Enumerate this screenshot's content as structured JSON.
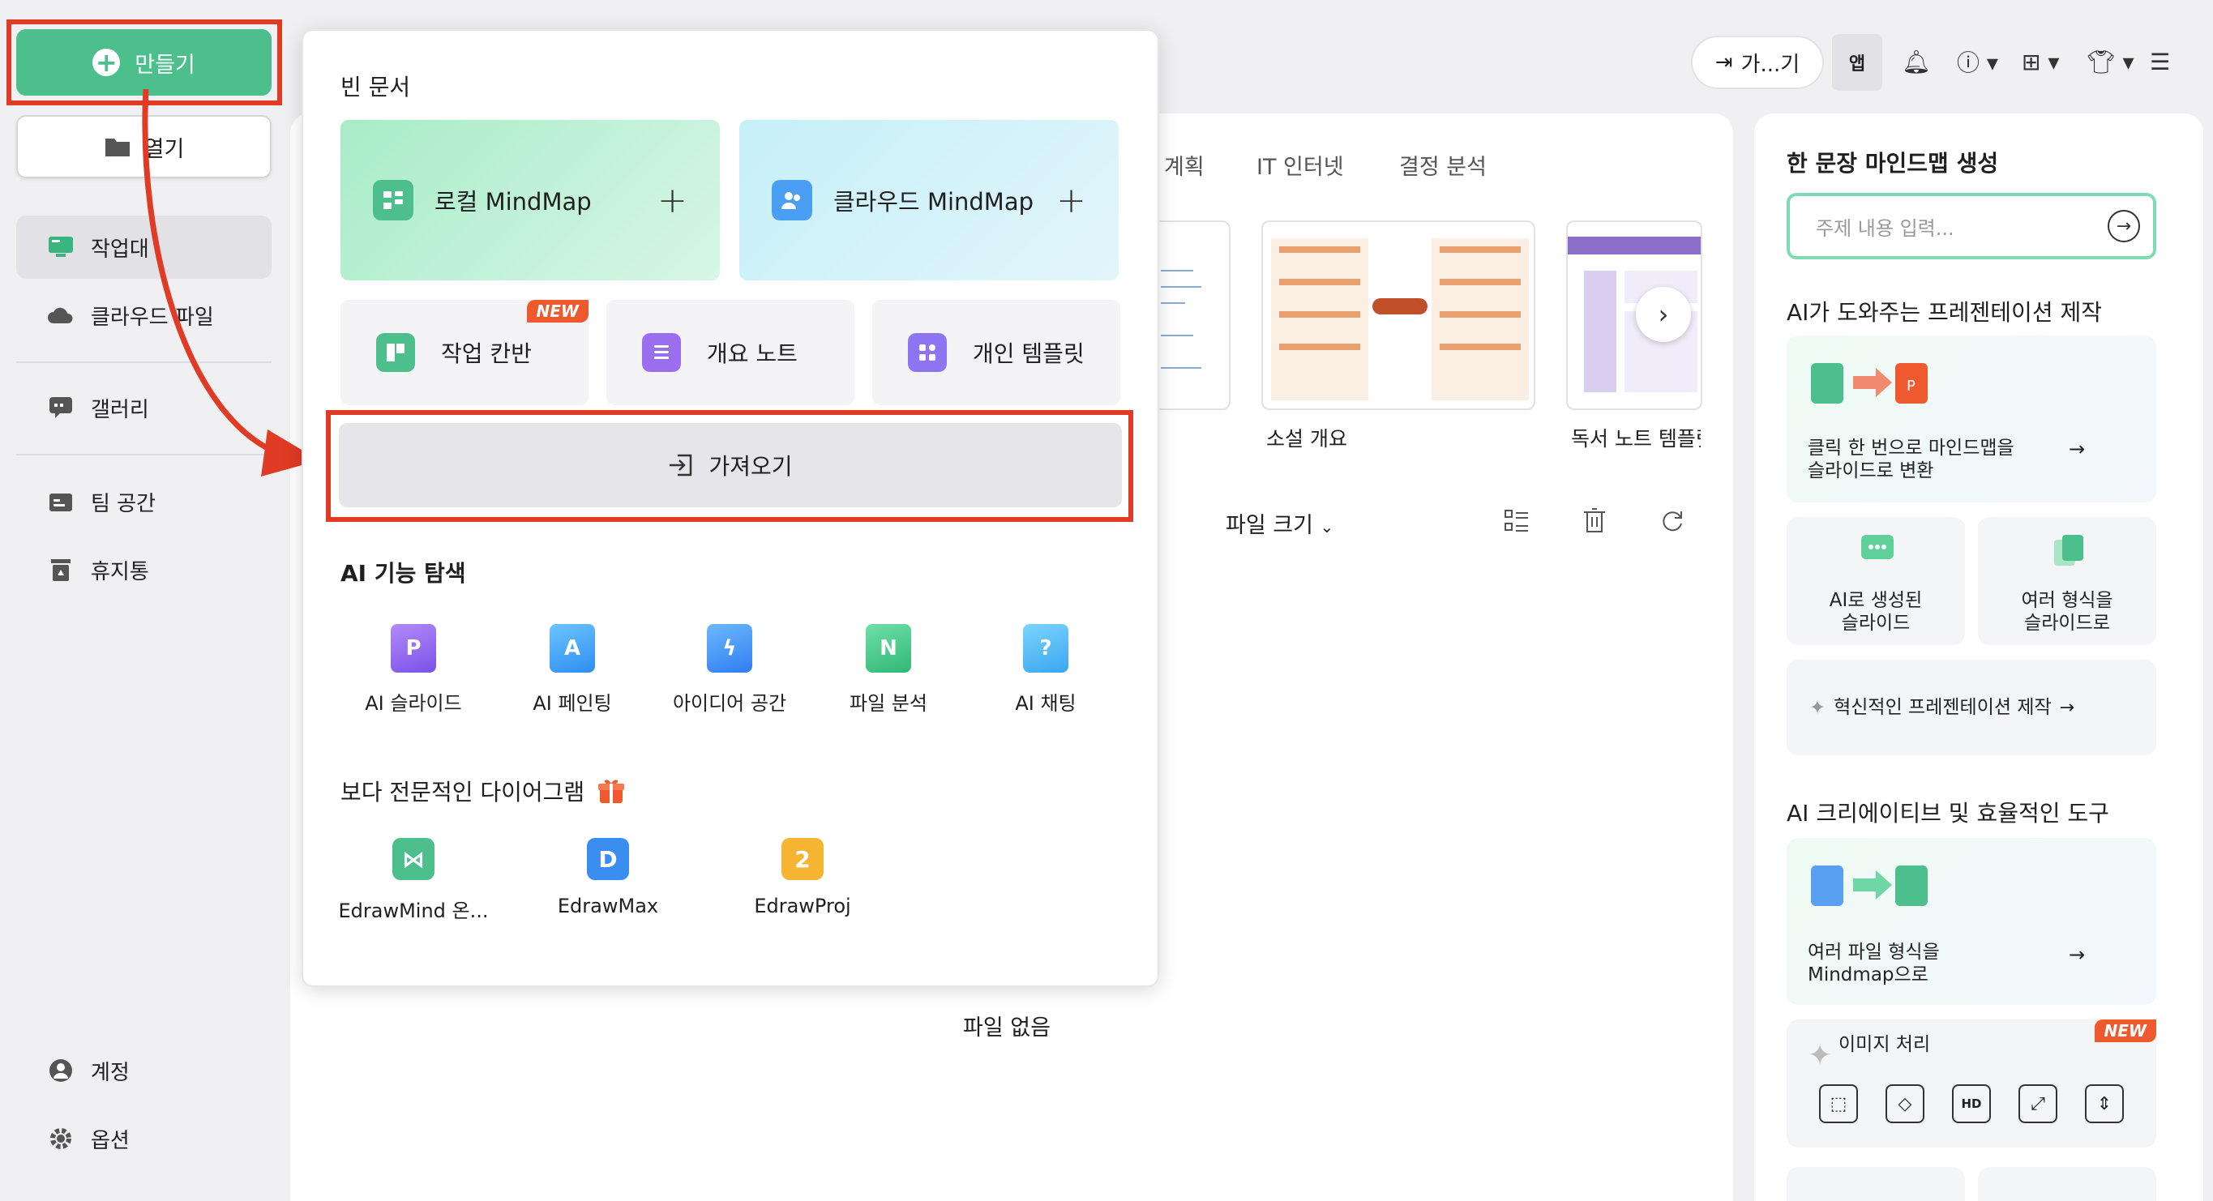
{
  "sidebar": {
    "create_label": "만들기",
    "open_label": "열기",
    "items": [
      {
        "label": "작업대"
      },
      {
        "label": "클라우드 파일"
      },
      {
        "label": "갤러리"
      },
      {
        "label": "팀 공간"
      },
      {
        "label": "휴지통"
      }
    ],
    "account_label": "계정",
    "options_label": "옵션"
  },
  "topbar": {
    "import_pill_label": "가...기",
    "app_label": "앱"
  },
  "main": {
    "tabs": [
      "계획",
      "IT 인터넷",
      "결정 분석"
    ],
    "templates": [
      {
        "label": "소설 개요"
      },
      {
        "label": "독서 노트 템플릿"
      }
    ],
    "file_size_label": "파일 크기",
    "no_file_label": "파일 없음"
  },
  "popup": {
    "blank_title": "빈 문서",
    "local_mindmap": "로컬 MindMap",
    "cloud_mindmap": "클라우드 MindMap",
    "task_kanban": "작업 칸반",
    "new_badge": "NEW",
    "outline_note": "개요 노트",
    "personal_template": "개인 템플릿",
    "import_label": "가져오기",
    "ai_title": "AI 기능 탐색",
    "ai_items": [
      {
        "label": "AI 슬라이드"
      },
      {
        "label": "AI 페인팅"
      },
      {
        "label": "아이디어 공간"
      },
      {
        "label": "파일 분석"
      },
      {
        "label": "AI 채팅"
      }
    ],
    "pro_title": "보다 전문적인 다이어그램",
    "products": [
      {
        "label": "EdrawMind 온..."
      },
      {
        "label": "EdrawMax"
      },
      {
        "label": "EdrawProj"
      }
    ]
  },
  "right_panel": {
    "mindmap_title": "한 문장 마인드맵 생성",
    "topic_placeholder": "주제 내용 입력...",
    "ppt_title": "AI가 도와주는 프레젠테이션 제작",
    "convert_text_1": "클릭 한 번으로 마인드맵을",
    "convert_text_2": "슬라이드로 변환",
    "ai_generated_1": "AI로 생성된",
    "ai_generated_2": "슬라이드",
    "multi_format_1": "여러 형식을",
    "multi_format_2": "슬라이드로",
    "innovative": "혁신적인 프레젠테이션 제작",
    "tools_title": "AI 크리에이티브 및 효율적인 도구",
    "files_to_mm_1": "여러 파일 형식을",
    "files_to_mm_2": "Mindmap으로",
    "image_processing": "이미지 처리",
    "new_badge": "NEW",
    "image_tool_hd": "HD"
  },
  "colors": {
    "brand_green": "#4dbf8c",
    "highlight_red": "#e03b24",
    "new_orange": "#ee5a2d"
  }
}
